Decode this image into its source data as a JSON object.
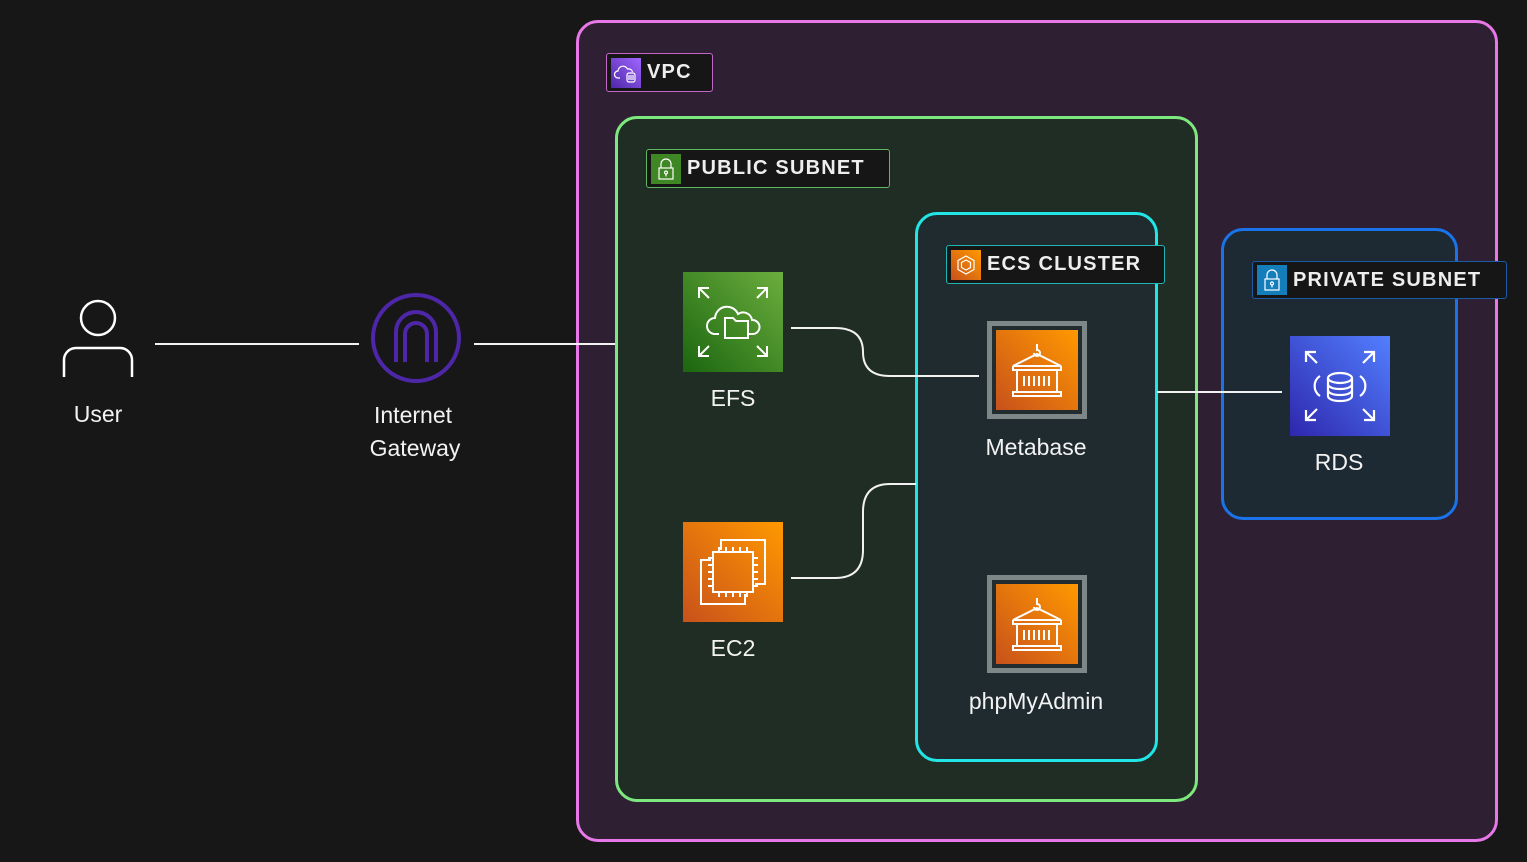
{
  "groups": {
    "vpc": {
      "label": "VPC",
      "border": "#e878e8",
      "fill": "#2e1f33",
      "icon": "vpc-cloud-icon"
    },
    "public_subnet": {
      "label": "PUBLIC SUBNET",
      "border": "#7de87d",
      "fill": "#202d24",
      "icon": "lock-icon"
    },
    "ecs_cluster": {
      "label": "ECS CLUSTER",
      "border": "#22e6e6",
      "fill": "#1f2b2f",
      "icon": "ecs-icon"
    },
    "private_subnet": {
      "label": "PRIVATE SUBNET",
      "border": "#1a73e8",
      "fill": "#1e2a33",
      "icon": "lock-icon"
    }
  },
  "nodes": {
    "user": {
      "label": "User",
      "icon": "user-icon"
    },
    "igw": {
      "label_line1": "Internet",
      "label_line2": "Gateway",
      "icon": "internet-gateway-icon",
      "color": "#4d27a8"
    },
    "efs": {
      "label": "EFS",
      "icon": "efs-icon",
      "color": "#3f8624"
    },
    "ec2": {
      "label": "EC2",
      "icon": "ec2-icon",
      "color": "#ed7100"
    },
    "metabase": {
      "label": "Metabase",
      "icon": "container-icon"
    },
    "phpmyadmin": {
      "label": "phpMyAdmin",
      "icon": "container-icon"
    },
    "rds": {
      "label": "RDS",
      "icon": "rds-icon",
      "color": "#3b48cc"
    }
  },
  "edges": [
    [
      "user",
      "igw"
    ],
    [
      "igw",
      "public_subnet"
    ],
    [
      "efs",
      "metabase"
    ],
    [
      "ec2",
      "ecs_cluster"
    ],
    [
      "ecs_cluster",
      "rds"
    ]
  ]
}
